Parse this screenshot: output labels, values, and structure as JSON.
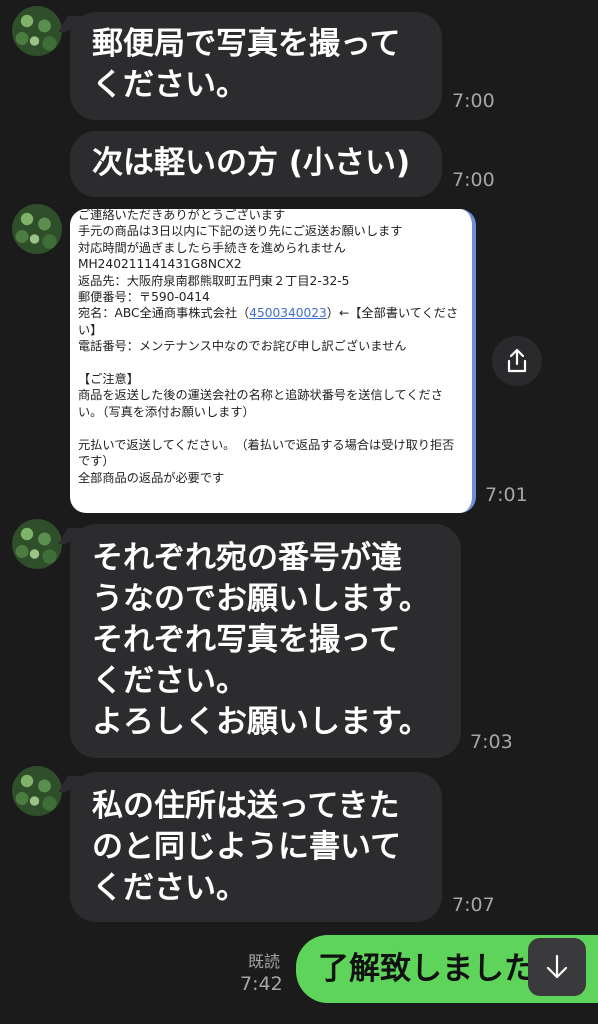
{
  "messages": [
    {
      "text": "郵便局で写真を撮って\nください。",
      "time": "7:00"
    },
    {
      "text": "次は軽いの方 (小さい)",
      "time": "7:00"
    },
    {
      "image_lines_before": "ご連絡いただきありがとうございます\n手元の商品は3日以内に下記の送り先にご返送お願いします\n対応時間が過ぎましたら手続きを進められません\nMH240211141431G8NCX2\n返品先：大阪府泉南郡熊取町五門東２丁目2-32-5\n郵便番号：〒590-0414\n宛名：ABC全通商事株式会社（",
      "image_link": "4500340023",
      "image_lines_after": "）←【全部書いてください】\n電話番号：メンテナンス中なのでお詫び申し訳ございません\n\n【ご注意】\n商品を返送した後の運送会社の名称と追跡状番号を送信してください。（写真を添付お願いします）\n\n元払いで返送してください。　（着払いで返品する場合は受け取り拒否です）\n全部商品の返品が必要です",
      "time": "7:01"
    },
    {
      "text": "それぞれ宛の番号が違\nうなのでお願いします。\nそれぞれ写真を撮って\nください。\nよろしくお願いします。",
      "time": "7:03"
    },
    {
      "text": "私の住所は送ってきた\nのと同じように書いて\nください。",
      "time": "7:07"
    }
  ],
  "my_message": {
    "text": "了解致しました",
    "read_label": "既読",
    "time": "7:42"
  },
  "icons": {
    "share": "share-icon",
    "scroll_down": "arrow-down-icon"
  },
  "colors": {
    "background": "#1b1b1b",
    "bubble": "#2c2c2e",
    "my_bubble": "#5fd45a",
    "link": "#3f6fcf"
  }
}
